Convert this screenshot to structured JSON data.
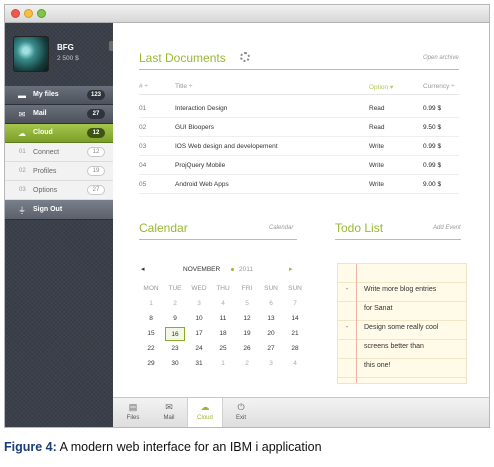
{
  "sidebar": {
    "user": {
      "name": "BFG",
      "balance": "2 500 $"
    },
    "menu": [
      {
        "label": "My files",
        "badge": "123",
        "icon": "folder-icon"
      },
      {
        "label": "Mail",
        "badge": "27",
        "icon": "mail-icon"
      },
      {
        "label": "Cloud",
        "badge": "12",
        "icon": "cloud-icon",
        "active": true
      }
    ],
    "submenu": [
      {
        "num": "01",
        "label": "Connect",
        "badge": "12"
      },
      {
        "num": "02",
        "label": "Profiles",
        "badge": "19"
      },
      {
        "num": "03",
        "label": "Options",
        "badge": "27"
      }
    ],
    "signout": {
      "label": "Sign Out",
      "icon": "plug-icon"
    }
  },
  "documents": {
    "title": "Last Documents",
    "link": "Open archive",
    "headers": {
      "num": "# ÷",
      "title": "Title ÷",
      "option": "Option ▾",
      "currency": "Currency ÷"
    },
    "rows": [
      {
        "num": "01",
        "title": "Interaction Design",
        "option": "Read",
        "price": "0.99 $"
      },
      {
        "num": "02",
        "title": "GUI Bloopers",
        "option": "Read",
        "price": "9.50 $"
      },
      {
        "num": "03",
        "title": "IOS Web design and developement",
        "option": "Write",
        "price": "0.99 $"
      },
      {
        "num": "04",
        "title": "ProjQuery Mobile",
        "option": "Write",
        "price": "0.99 $"
      },
      {
        "num": "05",
        "title": "Android Web Apps",
        "option": "Write",
        "price": "9.00 $"
      }
    ]
  },
  "calendar": {
    "title": "Calendar",
    "link": "Calendar",
    "month": "NOVEMBER",
    "year": "2011",
    "prev": "◂",
    "next": "▸",
    "weekdays": [
      "MON",
      "TUE",
      "WED",
      "THU",
      "FRI",
      "SUN",
      "SUN"
    ],
    "weeks": [
      [
        {
          "d": "1",
          "m": true
        },
        {
          "d": "2",
          "m": true
        },
        {
          "d": "3",
          "m": true
        },
        {
          "d": "4",
          "m": true
        },
        {
          "d": "5",
          "m": true
        },
        {
          "d": "6",
          "m": true
        },
        {
          "d": "7",
          "m": true
        }
      ],
      [
        {
          "d": "8"
        },
        {
          "d": "9"
        },
        {
          "d": "10"
        },
        {
          "d": "11"
        },
        {
          "d": "12"
        },
        {
          "d": "13"
        },
        {
          "d": "14"
        }
      ],
      [
        {
          "d": "15"
        },
        {
          "d": "16",
          "t": true
        },
        {
          "d": "17"
        },
        {
          "d": "18"
        },
        {
          "d": "19"
        },
        {
          "d": "20"
        },
        {
          "d": "21"
        }
      ],
      [
        {
          "d": "22"
        },
        {
          "d": "23"
        },
        {
          "d": "24"
        },
        {
          "d": "25"
        },
        {
          "d": "26"
        },
        {
          "d": "27"
        },
        {
          "d": "28"
        }
      ],
      [
        {
          "d": "29"
        },
        {
          "d": "30"
        },
        {
          "d": "31"
        },
        {
          "d": "1",
          "m": true
        },
        {
          "d": "2",
          "m": true
        },
        {
          "d": "3",
          "m": true
        },
        {
          "d": "4",
          "m": true
        }
      ]
    ]
  },
  "todo": {
    "title": "Todo List",
    "link": "Add Event",
    "lines": [
      "Write more blog entries",
      "for  Sanat",
      "Design some really cool",
      "screens better than",
      "this one!"
    ],
    "bullets": [
      0,
      2
    ]
  },
  "tabbar": [
    {
      "label": "Files",
      "icon": "files-icon",
      "glyph": "▤"
    },
    {
      "label": "Mail",
      "icon": "mail-icon",
      "glyph": "✉"
    },
    {
      "label": "Cloud",
      "icon": "cloud-icon",
      "glyph": "☁",
      "active": true
    },
    {
      "label": "Exit",
      "icon": "plug-icon",
      "glyph": "⏻"
    }
  ],
  "caption": {
    "figure": "Figure 4:",
    "text": "A modern web interface for an IBM i application"
  },
  "colors": {
    "accent": "#9ab832",
    "sidebar": "#3a3f49",
    "todo_paper": "#fffbe8"
  }
}
